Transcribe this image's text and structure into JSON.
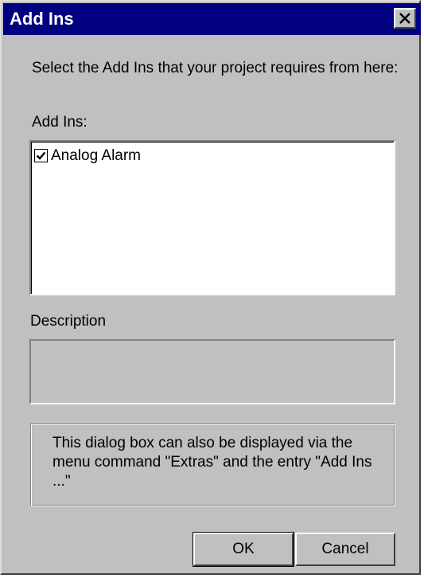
{
  "window": {
    "title": "Add Ins",
    "close_glyph": "✕"
  },
  "intro_text": "Select the Add Ins that your project requires from here:",
  "addins_label": "Add Ins:",
  "addins_list": [
    {
      "label": "Analog Alarm",
      "checked": true
    }
  ],
  "description_label": "Description",
  "description_value": "",
  "info_text": "This dialog box can also be displayed via the menu command \"Extras\" and the entry \"Add Ins ...\"",
  "buttons": {
    "ok": "OK",
    "cancel": "Cancel"
  },
  "colors": {
    "titlebar": "#000080",
    "face": "#c0c0c0"
  }
}
